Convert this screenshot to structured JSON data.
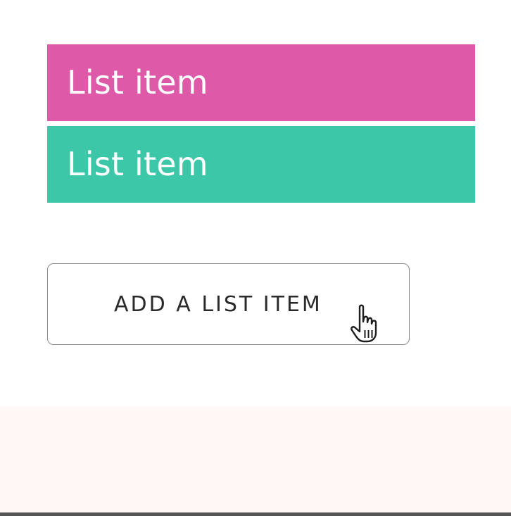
{
  "list": {
    "items": [
      {
        "label": "List item",
        "color": "#DE5AA8"
      },
      {
        "label": "List item",
        "color": "#3CC8A8"
      }
    ]
  },
  "add_button": {
    "label": "ADD A LIST ITEM"
  },
  "cursor": {
    "icon": "hand-pointer-icon"
  }
}
